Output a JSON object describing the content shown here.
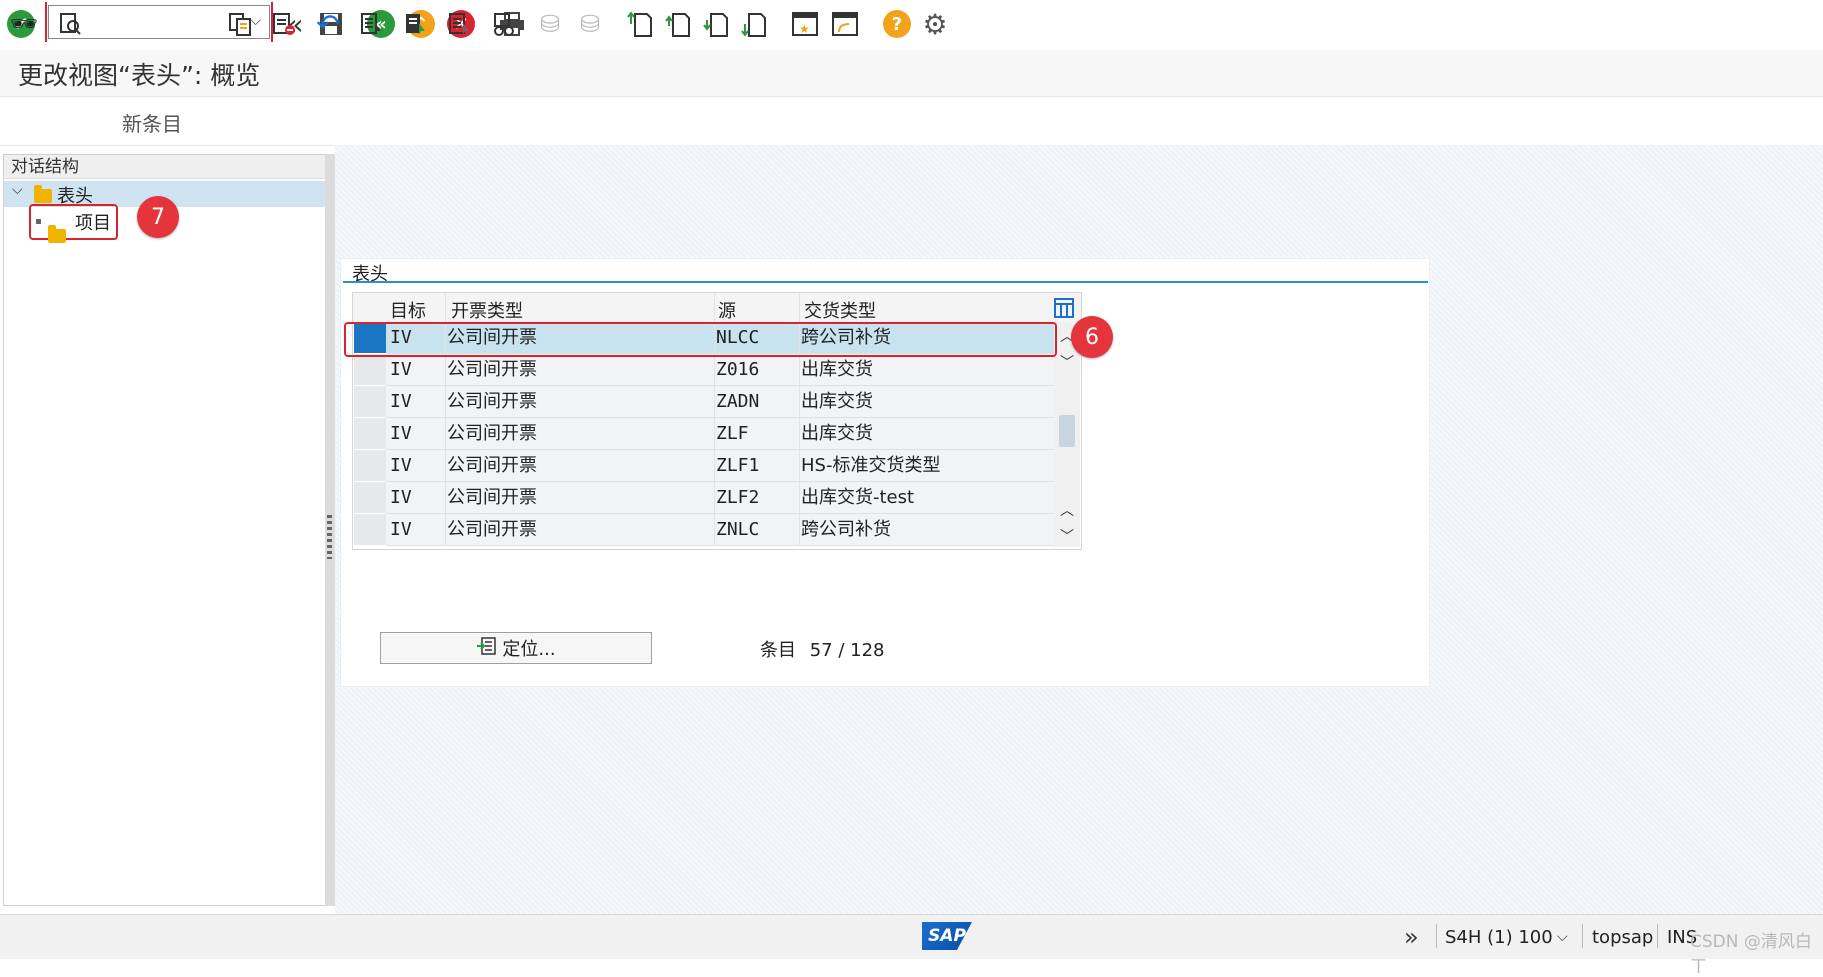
{
  "toolbar": {
    "command_field_value": "",
    "icons": [
      "check-icon",
      "back-nav-icon",
      "save-icon",
      "back-icon",
      "exit-icon",
      "cancel-icon",
      "print-icon",
      "find-icon",
      "find-next-icon",
      "first-page-icon",
      "prev-page-icon",
      "next-page-icon",
      "last-page-icon",
      "new-session-icon",
      "shortcut-icon",
      "help-icon",
      "settings-icon"
    ]
  },
  "title": "更改视图“表头”: 概览",
  "toolbar2": {
    "new_entries": "新条目",
    "icons": [
      "display-change-icon",
      "detail-icon",
      "copy-icon",
      "delete-icon",
      "undo-icon",
      "select-all-icon",
      "select-block-icon",
      "deselect-all-icon",
      "print-standard-icon"
    ]
  },
  "tree": {
    "header": "对话结构",
    "nodes": [
      {
        "label": "表头"
      },
      {
        "label": "项目"
      }
    ],
    "badge": "7"
  },
  "panel": {
    "title": "表头"
  },
  "table": {
    "columns": [
      "目标",
      "开票类型",
      "源",
      "交货类型"
    ],
    "rows": [
      {
        "c1": "IV",
        "c2": "公司间开票",
        "c3": "NLCC",
        "c4": "跨公司补货"
      },
      {
        "c1": "IV",
        "c2": "公司间开票",
        "c3": "Z016",
        "c4": "出库交货"
      },
      {
        "c1": "IV",
        "c2": "公司间开票",
        "c3": "ZADN",
        "c4": "出库交货"
      },
      {
        "c1": "IV",
        "c2": "公司间开票",
        "c3": "ZLF",
        "c4": "出库交货"
      },
      {
        "c1": "IV",
        "c2": "公司间开票",
        "c3": "ZLF1",
        "c4": "HS-标准交货类型"
      },
      {
        "c1": "IV",
        "c2": "公司间开票",
        "c3": "ZLF2",
        "c4": "出库交货-test"
      },
      {
        "c1": "IV",
        "c2": "公司间开票",
        "c3": "ZNLC",
        "c4": "跨公司补货"
      }
    ],
    "badge": "6"
  },
  "position_button": "定位...",
  "entries_label": "条目",
  "entries_value": "57 / 128",
  "status": {
    "logo": "SAP",
    "system": "S4H (1) 100",
    "host": "topsap",
    "mode": "INS",
    "watermark": "CSDN @清风白ㄒ"
  },
  "colors": {
    "accent": "#2d8fcf",
    "highlight": "#d9232e",
    "selected_row": "#c9e2f0"
  }
}
